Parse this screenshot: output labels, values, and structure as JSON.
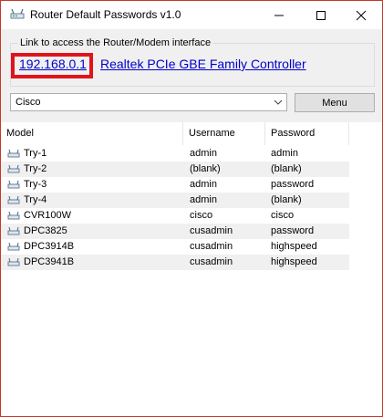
{
  "window": {
    "title": "Router Default Passwords v1.0"
  },
  "link_group": {
    "legend": "Link to access the Router/Modem interface",
    "ip_address": "192.168.0.1",
    "adapter_name": "Realtek PCIe GBE Family Controller"
  },
  "brand_select": {
    "selected": "Cisco"
  },
  "menu_button": {
    "label": "Menu"
  },
  "table": {
    "columns": [
      "Model",
      "Username",
      "Password"
    ],
    "rows": [
      {
        "model": "Try-1",
        "username": "admin",
        "password": "admin"
      },
      {
        "model": "Try-2",
        "username": "(blank)",
        "password": "(blank)"
      },
      {
        "model": "Try-3",
        "username": "admin",
        "password": "password"
      },
      {
        "model": "Try-4",
        "username": "admin",
        "password": "(blank)"
      },
      {
        "model": "CVR100W",
        "username": "cisco",
        "password": "cisco"
      },
      {
        "model": "DPC3825",
        "username": "cusadmin",
        "password": "password"
      },
      {
        "model": "DPC3914B",
        "username": "cusadmin",
        "password": "highspeed"
      },
      {
        "model": "DPC3941B",
        "username": "cusadmin",
        "password": "highspeed"
      }
    ]
  },
  "colors": {
    "highlight": "#e0141c",
    "link": "#0000cc",
    "window_border": "#c33a2a"
  },
  "icons": {
    "app": "router-icon",
    "row": "router-icon",
    "dropdown": "chevron-down-icon"
  }
}
